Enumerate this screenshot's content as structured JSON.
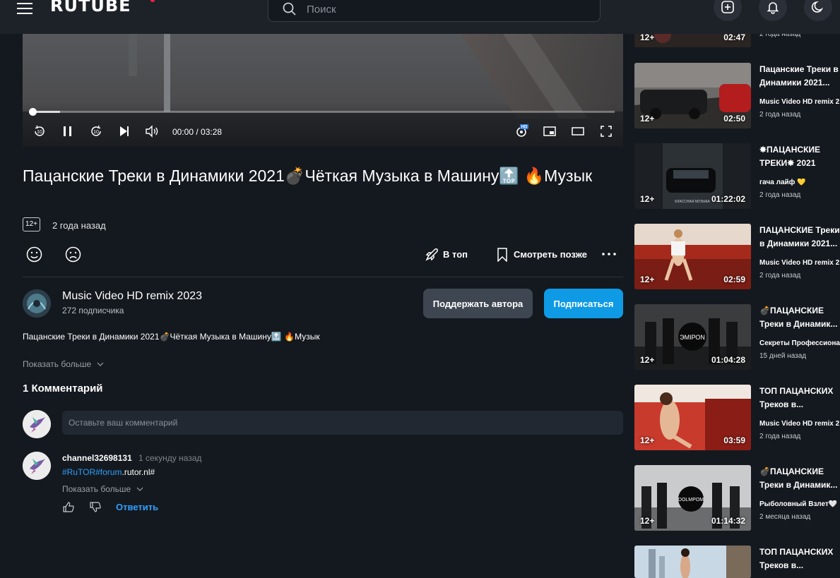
{
  "header": {
    "logo": "RUTUBE",
    "search_placeholder": "Поиск"
  },
  "player": {
    "time": "00:00 / 03:28",
    "progress_fraction": 0.0,
    "hd_badge": "HD"
  },
  "video": {
    "title": "Пацанские Треки в Динамики 2021💣Чёткая Музыка в Машину🔝 🔥Музык",
    "age": "12+",
    "date": "2 года назад",
    "actions": {
      "top": "В топ",
      "later": "Смотреть позже"
    }
  },
  "channel": {
    "name": "Music Video HD remix 2023",
    "subs": "272 подписчика",
    "support_label": "Поддержать автора",
    "subscribe_label": "Подписаться"
  },
  "description": {
    "text": "Пацанские Треки в Динамики 2021💣Чёткая Музыка в Машину🔝 🔥Музык",
    "show_more": "Показать больше"
  },
  "comments": {
    "title": "1 Комментарий",
    "input_placeholder": "Оставьте ваш комментарий",
    "items": [
      {
        "user": "channel32698131",
        "when": "1 секунду назад",
        "text_link": "#RuTOR#forum",
        "text_rest": ".rutor.nl#",
        "show_more": "Показать больше",
        "reply": "Ответить"
      }
    ]
  },
  "related": [
    {
      "age": "12+",
      "duration": "02:47",
      "title1": "",
      "title2": "",
      "channel": "",
      "date": "2 года назад"
    },
    {
      "age": "12+",
      "duration": "02:50",
      "title1": "Пацанские Треки в",
      "title2": "Динамики 2021...",
      "channel": "Music Video HD remix 2",
      "date": "2 года назад"
    },
    {
      "age": "12+",
      "duration": "01:22:02",
      "title1": "✸ПАЦАНСКИЕ",
      "title2": "ТРЕКИ✸ 2021",
      "channel": "гача лайф 💛",
      "date": "2 года назад"
    },
    {
      "age": "12+",
      "duration": "02:59",
      "title1": "ПАЦАНСКИЕ Треки",
      "title2": "в Динамики 2021...",
      "channel": "Music Video HD remix 2",
      "date": "2 года назад"
    },
    {
      "age": "12+",
      "duration": "01:04:28",
      "title1": "💣ПАЦАНСКИЕ",
      "title2": "Треки в Динамик...",
      "channel": "Секреты Профессиона",
      "date": "15 дней назад"
    },
    {
      "age": "12+",
      "duration": "03:59",
      "title1": "ТОП ПАЦАНСКИХ",
      "title2": "Треков в...",
      "channel": "Music Video HD remix 2",
      "date": "2 года назад"
    },
    {
      "age": "12+",
      "duration": "01:14:32",
      "title1": "💣ПАЦАНСКИЕ",
      "title2": "Треки в Динамик...",
      "channel": "Рыболовный Взлет🤍",
      "date": "2 месяца назад"
    },
    {
      "age": "",
      "duration": "",
      "title1": "ТОП ПАЦАНСКИХ",
      "title2": "Треков в...",
      "channel": "",
      "date": ""
    }
  ],
  "thumb_texts": {
    "t3": "КЛАССНАЯ МУЗЫКА",
    "t5": "ЭМIРОN",
    "t7": "DOLMPOM"
  }
}
